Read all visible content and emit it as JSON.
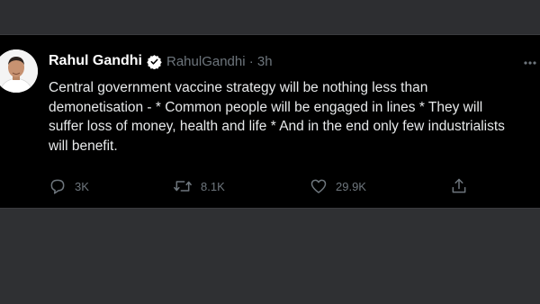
{
  "tweet": {
    "author_name": "Rahul Gandhi",
    "verified": true,
    "handle_time": "RahulGandhi · 3h",
    "more_icon": "more-horizontal-icon",
    "lines": [
      "Central government vaccine strategy will be nothing less than",
      "demonetisation - * Common people will be engaged in lines * They will",
      "suffer loss of money, health and life * And in the end only few industrialists",
      "will benefit."
    ],
    "actions": {
      "reply_count": "3K",
      "retweet_count": "8.1K",
      "like_count": "29.9K",
      "share_icon": "share-icon"
    }
  },
  "colors": {
    "card_background": "#000000",
    "page_background": "#2f3033",
    "text": "#e7e9ea",
    "muted": "#6e767d",
    "verified": "#ffffff"
  }
}
